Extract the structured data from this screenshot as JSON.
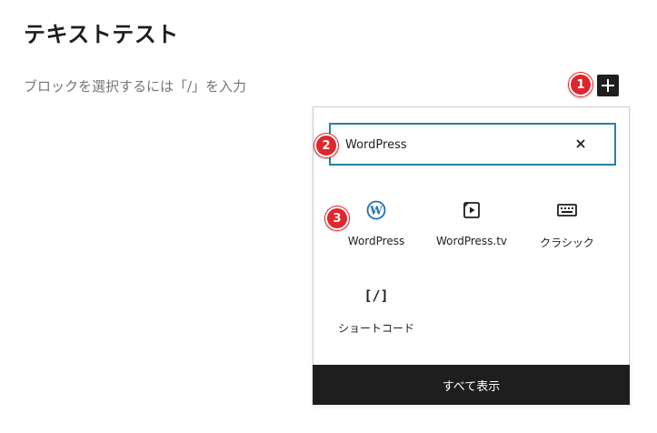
{
  "post": {
    "title": "テキストテスト",
    "block_placeholder": "ブロックを選択するには「/」を入力"
  },
  "markers": [
    "1",
    "2",
    "3"
  ],
  "inserter": {
    "search": {
      "value": "WordPress"
    },
    "results": [
      {
        "label": "WordPress",
        "icon": "wordpress-icon",
        "icon_color": "#2271b1"
      },
      {
        "label": "WordPress.tv",
        "icon": "video-play-icon"
      },
      {
        "label": "クラシック",
        "icon": "keyboard-icon"
      },
      {
        "label": "ショートコード",
        "icon": "shortcode-icon",
        "icon_text": "[/]"
      }
    ],
    "show_all_label": "すべて表示"
  },
  "colors": {
    "marker": "#e0262c",
    "accent": "#2a7fa8",
    "dark": "#1e1e1e"
  }
}
